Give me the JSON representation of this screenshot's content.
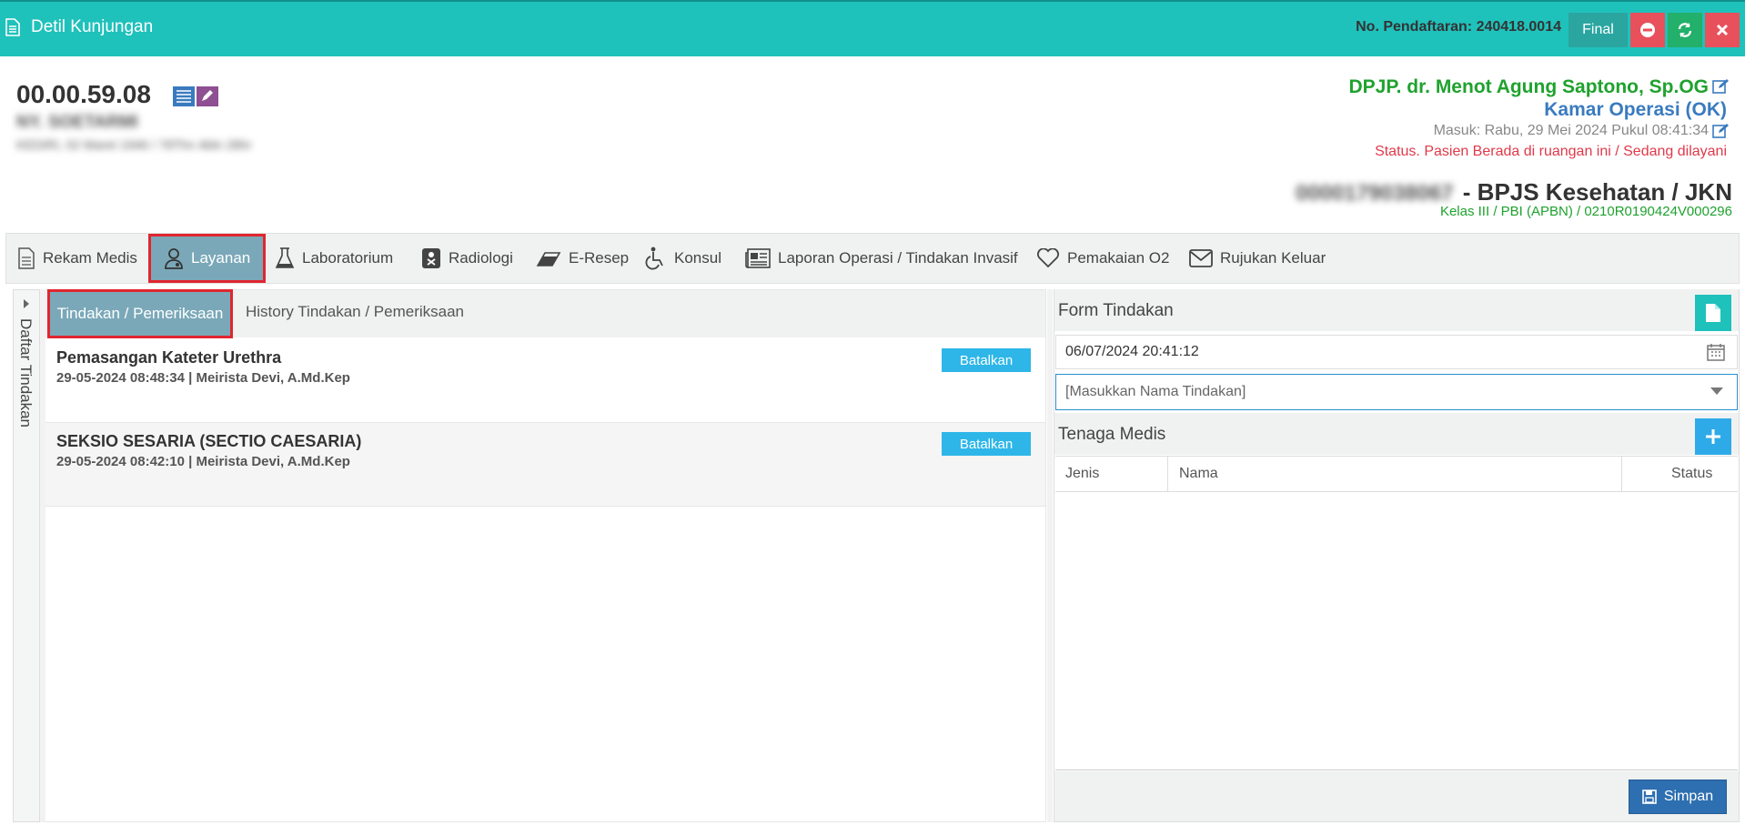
{
  "window": {
    "title": "Detil Kunjungan",
    "registration": "No. Pendaftaran: 240418.0014",
    "final_label": "Final"
  },
  "patient": {
    "rm_number": "00.00.59.08",
    "name": "NY. SOETARMI",
    "dob": "KEDIRI, 02 Maret 1946 / 78Thn 4bln 28hr",
    "dpjp": "DPJP. dr. Menot Agung Saptono, Sp.OG",
    "room": "Kamar Operasi (OK)",
    "admitted": "Masuk: Rabu, 29 Mei 2024 Pukul 08:41:34",
    "status": "Status. Pasien Berada di ruangan ini / Sedang dilayani",
    "bpjs_number": "0000179038067",
    "insurance": "- BPJS Kesehatan / JKN",
    "class_info": "Kelas III / PBI (APBN) / 0210R0190424V000296"
  },
  "tabs": [
    {
      "label": "Rekam Medis",
      "icon": "file-icon"
    },
    {
      "label": "Layanan",
      "icon": "doctor-icon"
    },
    {
      "label": "Laboratorium",
      "icon": "flask-icon"
    },
    {
      "label": "Radiologi",
      "icon": "xray-icon"
    },
    {
      "label": "E-Resep",
      "icon": "eraser-icon"
    },
    {
      "label": "Konsul",
      "icon": "wheelchair-icon"
    },
    {
      "label": "Laporan Operasi / Tindakan Invasif",
      "icon": "newspaper-icon"
    },
    {
      "label": "Pemakaian O2",
      "icon": "heart-icon"
    },
    {
      "label": "Rujukan Keluar",
      "icon": "envelope-icon"
    }
  ],
  "sidebar": {
    "label": "Daftar Tindakan"
  },
  "subtabs": [
    {
      "label": "Tindakan / Pemeriksaan"
    },
    {
      "label": "History Tindakan / Pemeriksaan"
    }
  ],
  "procedures": [
    {
      "name": "Pemasangan Kateter Urethra",
      "meta": "29-05-2024 08:48:34 | Meirista Devi, A.Md.Kep",
      "action": "Batalkan"
    },
    {
      "name": "SEKSIO SESARIA (SECTIO CAESARIA)",
      "meta": "29-05-2024 08:42:10 | Meirista Devi, A.Md.Kep",
      "action": "Batalkan"
    }
  ],
  "form": {
    "title": "Form Tindakan",
    "datetime": "06/07/2024 20:41:12",
    "tindakan_placeholder": "[Masukkan Nama Tindakan]",
    "medis_title": "Tenaga Medis",
    "columns": [
      "Jenis",
      "Nama",
      "Status"
    ],
    "save_label": "Simpan"
  },
  "colors": {
    "titlebar": "#1fc1bb",
    "active_tab": "#7aa8b8",
    "highlight_border": "#e0262f",
    "dpjp": "#1fa22e",
    "room": "#3a7bbf",
    "status": "#e0394a"
  }
}
